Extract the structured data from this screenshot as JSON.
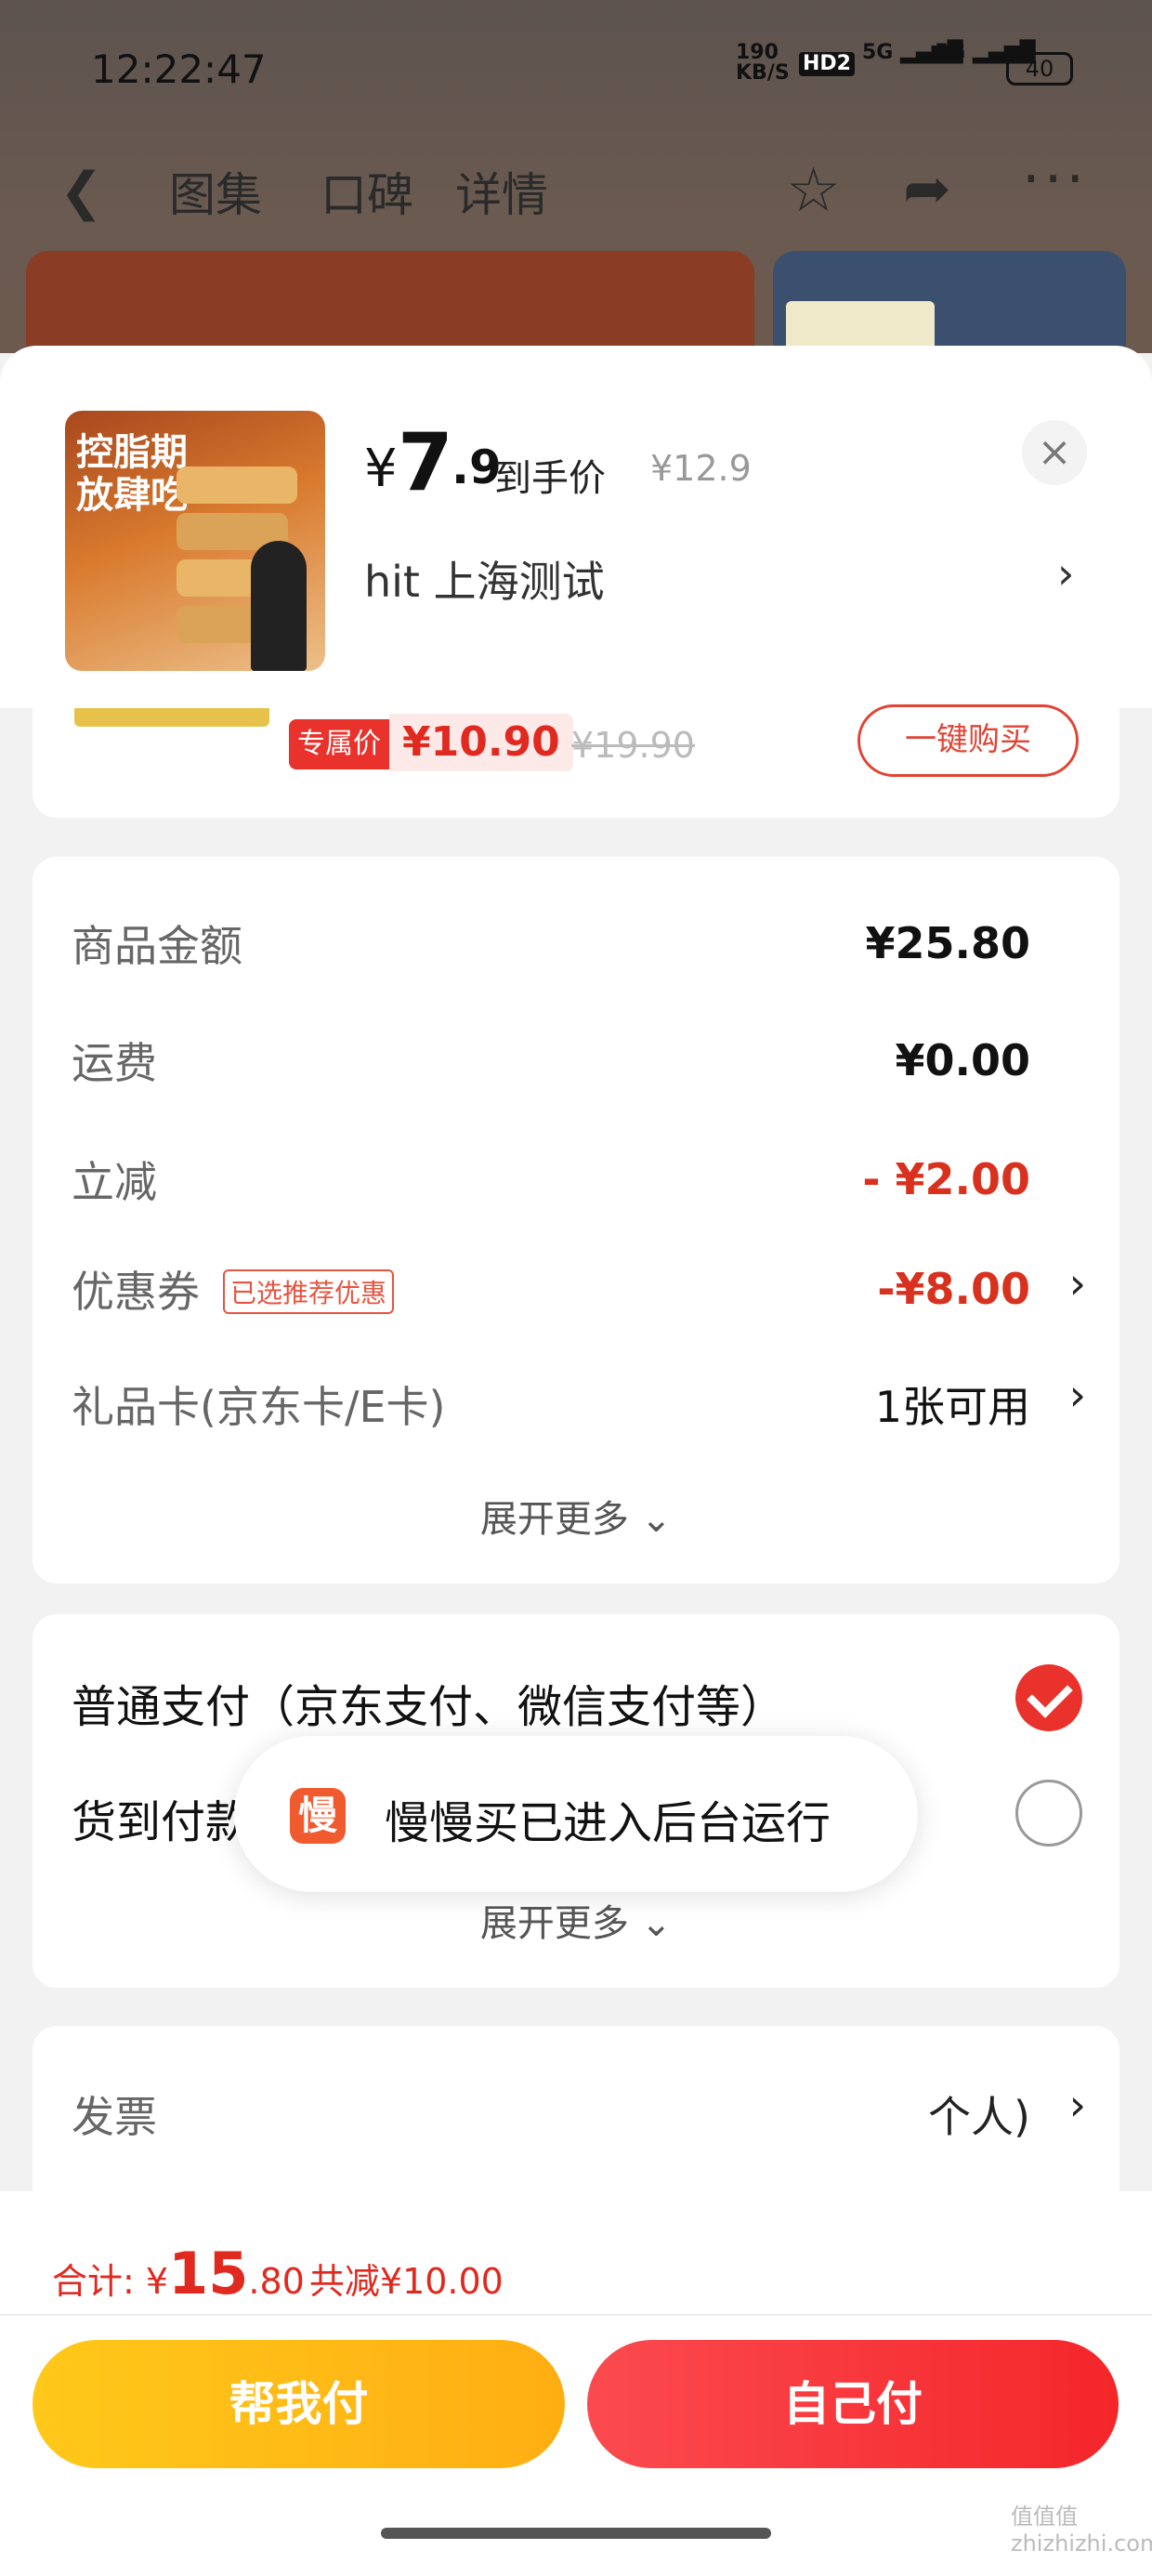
{
  "status_bar": {
    "time": "12:22:47",
    "net_speed": "190",
    "net_unit": "KB/S",
    "hd": "HD2",
    "sig1": "5G",
    "sig2": "5G",
    "battery": "40"
  },
  "top_nav": {
    "tabs": [
      "图集",
      "口碑",
      "详情"
    ]
  },
  "sheet": {
    "product": {
      "thumb_text": "控脂期\n放肆吃",
      "currency": "¥",
      "price_int": "7",
      "price_dec": ".9",
      "price_label": "到手价",
      "orig_price": "¥12.9",
      "shop": "hit  上海测试"
    },
    "promo": {
      "badge": "专属价",
      "price": "¥10.90",
      "orig": "¥19.90",
      "buy": "一键购买"
    },
    "amounts": {
      "rows": [
        {
          "label": "商品金额",
          "value": "¥25.80"
        },
        {
          "label": "运费",
          "value": "¥0.00"
        },
        {
          "label": "立减",
          "value": "- ¥2.00"
        },
        {
          "label": "优惠券",
          "value": "-¥8.00",
          "tag": "已选推荐优惠"
        },
        {
          "label": "礼品卡(京东卡/E卡)",
          "value": "1张可用"
        }
      ],
      "more": "展开更多"
    },
    "payment": {
      "options": [
        "普通支付（京东支付、微信支付等）",
        "货到付款"
      ],
      "more": "展开更多"
    },
    "invoice": {
      "label": "发票",
      "value": "个人)"
    }
  },
  "toast": {
    "icon_char": "慢",
    "text": "慢慢买已进入后台运行"
  },
  "footer": {
    "total_label": "合计: ",
    "total_yen": "¥",
    "total_int": "15",
    "total_dec": ".80",
    "discount": "共减¥10.00",
    "help_pay": "帮我付",
    "self_pay": "自己付",
    "watermark": "值值值 zhizhizhi.com"
  }
}
